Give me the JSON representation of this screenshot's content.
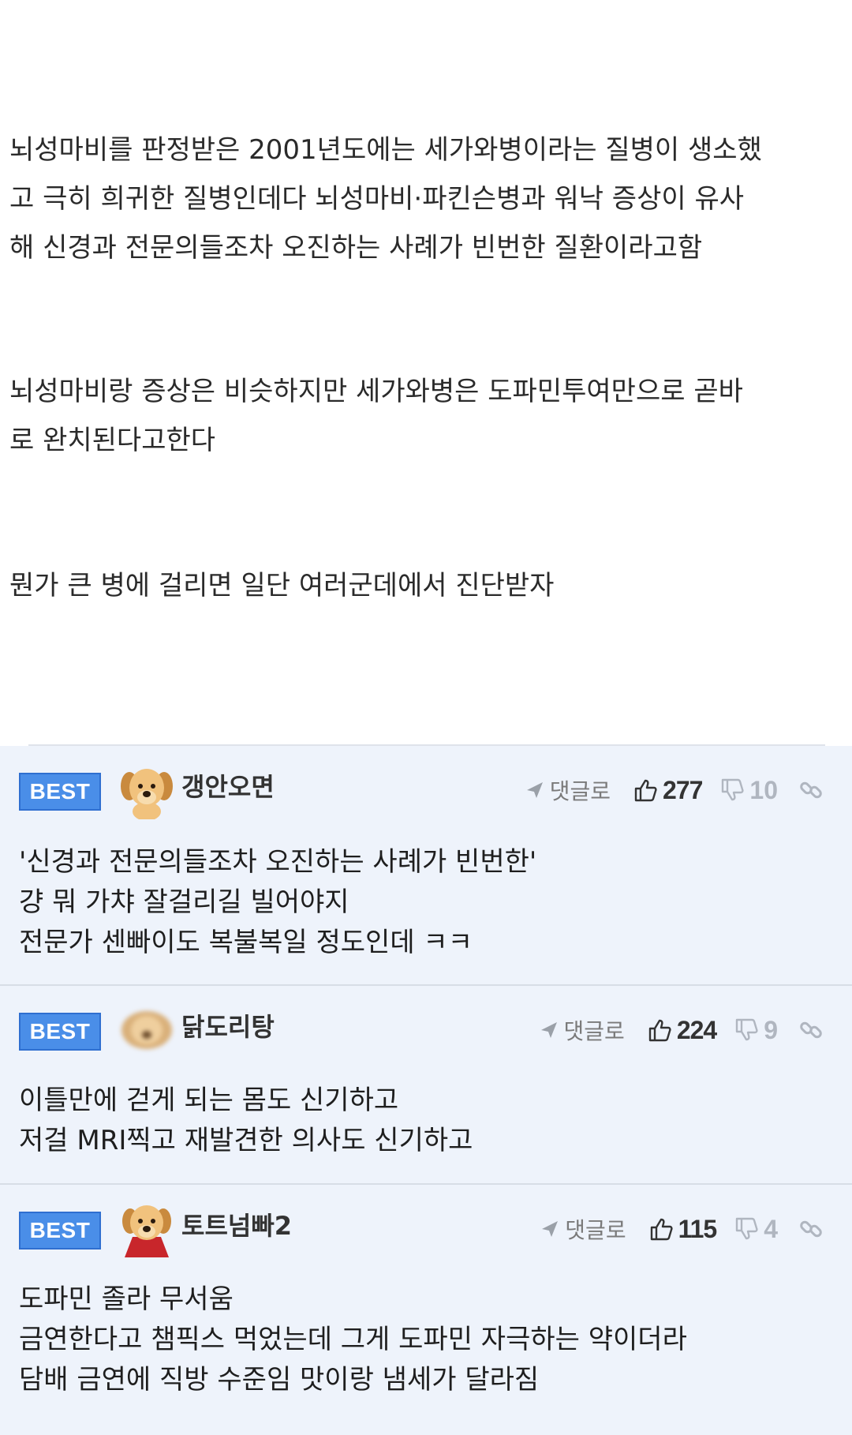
{
  "article": {
    "paragraphs": [
      "뇌성마비를 판정받은 2001년도에는 세가와병이라는 질병이 생소했\n고 극히 희귀한 질병인데다 뇌성마비·파킨슨병과 워낙 증상이 유사\n해 신경과 전문의들조차 오진하는 사례가 빈번한 질환이라고함",
      "뇌성마비랑 증상은 비슷하지만 세가와병은 도파민투여만으로 곧바\n로 완치된다고한다",
      "뭔가 큰 병에 걸리면 일단 여러군데에서 진단받자"
    ]
  },
  "comments": [
    {
      "badge": "BEST",
      "avatar": "puppy-avatar",
      "username": "갱안오면",
      "reply_label": "댓글로",
      "likes": "277",
      "dislikes": "10",
      "text": "'신경과 전문의들조차 오진하는 사례가 빈번한'\n걍 뭐 가챠 잘걸리길 빌어야지\n전문가 센빠이도 복불복일 정도인데 ㅋㅋ"
    },
    {
      "badge": "BEST",
      "avatar": "blurred-puppy-avatar",
      "username": "닭도리탕",
      "reply_label": "댓글로",
      "likes": "224",
      "dislikes": "9",
      "text": "이틀만에 걷게 되는 몸도 신기하고\n저걸 MRI찍고 재발견한 의사도 신기하고"
    },
    {
      "badge": "BEST",
      "avatar": "caped-puppy-avatar",
      "username": "토트넘빠2",
      "reply_label": "댓글로",
      "likes": "115",
      "dislikes": "4",
      "text": "도파민 졸라 무서움\n금연한다고 챔픽스 먹었는데 그게 도파민 자극하는 약이더라\n담배 금연에 직방 수준임 맛이랑 냄세가 달라짐"
    }
  ],
  "colors": {
    "badge": "#4a8ee8",
    "comment_bg": "#eef3fb",
    "separator": "#d7dde6"
  }
}
